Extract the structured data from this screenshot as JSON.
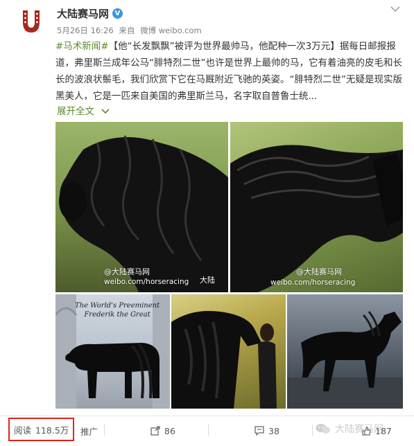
{
  "account": {
    "name": "大陆赛马网",
    "date": "5月26日 16:26",
    "source_prefix": "来自",
    "source": "微博 weibo.com"
  },
  "post": {
    "hashtag": "#马术新闻#",
    "text": "【他“长发飘飘”被评为世界最帅马，他配种一次3万元】据每日邮报报道，弗里斯兰成年公马“腓特烈二世”也许是世界上最帅的马，它有着油亮的皮毛和长长的波浪状鬃毛，我们欣赏下它在马厩附近飞驰的英姿。“腓特烈二世”无疑是现实版黑美人，它是一匹来自美国的弗里斯兰马，名字取自普鲁士统...",
    "expand_label": "展开全文",
    "expand_icon": "chevron-down-icon"
  },
  "photos": {
    "watermark_handle": "@大陆赛马网",
    "watermark_url": "weibo.com/horseracing",
    "watermark_partial": "大陆",
    "caption_line1": "The World's Preeminent",
    "caption_line2": "Frederik the Great"
  },
  "actions": {
    "read_label": "阅读",
    "read_count": "118.5万",
    "promote_label": "推广",
    "share_count": "86",
    "comment_count": "38",
    "like_count": "187",
    "brand_watermark": "大陆赛马网"
  },
  "colors": {
    "accent_green": "#5b8a2c",
    "verified_blue": "#3b95e6",
    "highlight_red": "#e2231a",
    "logo_red": "#a8281e"
  }
}
